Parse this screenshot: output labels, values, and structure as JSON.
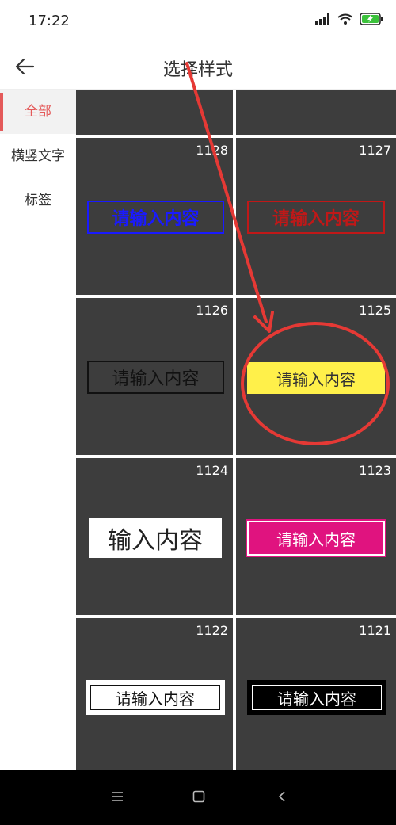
{
  "status": {
    "time": "17:22",
    "battery_color": "#3bc23b"
  },
  "appbar": {
    "title": "选择样式",
    "back_icon": "arrow-left-icon"
  },
  "sidebar": {
    "items": [
      {
        "label": "全部",
        "active": true
      },
      {
        "label": "横竖文字",
        "active": false
      },
      {
        "label": "标签",
        "active": false
      }
    ]
  },
  "styles": [
    {
      "id": "",
      "text": ""
    },
    {
      "id": "",
      "text": ""
    },
    {
      "id": "1128",
      "text": "请输入内容"
    },
    {
      "id": "1127",
      "text": "请输入内容"
    },
    {
      "id": "1126",
      "text": "请输入内容"
    },
    {
      "id": "1125",
      "text": "请输入内容"
    },
    {
      "id": "1124",
      "text": "输入内容"
    },
    {
      "id": "1123",
      "text": "请输入内容"
    },
    {
      "id": "1122",
      "text": "请输入内容"
    },
    {
      "id": "1121",
      "text": "请输入内容"
    }
  ],
  "colors": {
    "accent": "#e45a5a",
    "annotation": "#e53935",
    "tile_bg": "#3d3d3d",
    "blue": "#1a1aff",
    "red": "#c01818",
    "yellow": "#fff04a",
    "magenta": "#e0137f"
  },
  "navbar": {
    "menu_icon": "menu-icon",
    "home_icon": "square-home-icon",
    "back_icon": "triangle-back-icon"
  }
}
